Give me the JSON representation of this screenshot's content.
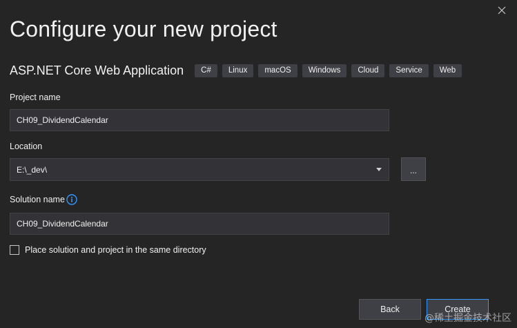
{
  "dialog": {
    "title": "Configure your new project",
    "template": {
      "name": "ASP.NET Core Web Application",
      "tags": [
        "C#",
        "Linux",
        "macOS",
        "Windows",
        "Cloud",
        "Service",
        "Web"
      ]
    }
  },
  "form": {
    "project_name": {
      "label": "Project name",
      "value": "CH09_DividendCalendar"
    },
    "location": {
      "label": "Location",
      "value": "E:\\_dev\\",
      "browse_label": "..."
    },
    "solution_name": {
      "label": "Solution name",
      "value": "CH09_DividendCalendar"
    },
    "same_directory": {
      "label": "Place solution and project in the same directory",
      "checked": false
    }
  },
  "buttons": {
    "back": "Back",
    "create": "Create"
  },
  "watermark": "@稀土掘金技术社区",
  "colors": {
    "background": "#252526",
    "field_background": "#333337",
    "tag_background": "#3f3f46",
    "accent_border": "#3399ff",
    "info_icon": "#3399ff"
  },
  "icons": {
    "close": "close-icon",
    "dropdown": "chevron-down-icon",
    "info": "info-icon"
  }
}
